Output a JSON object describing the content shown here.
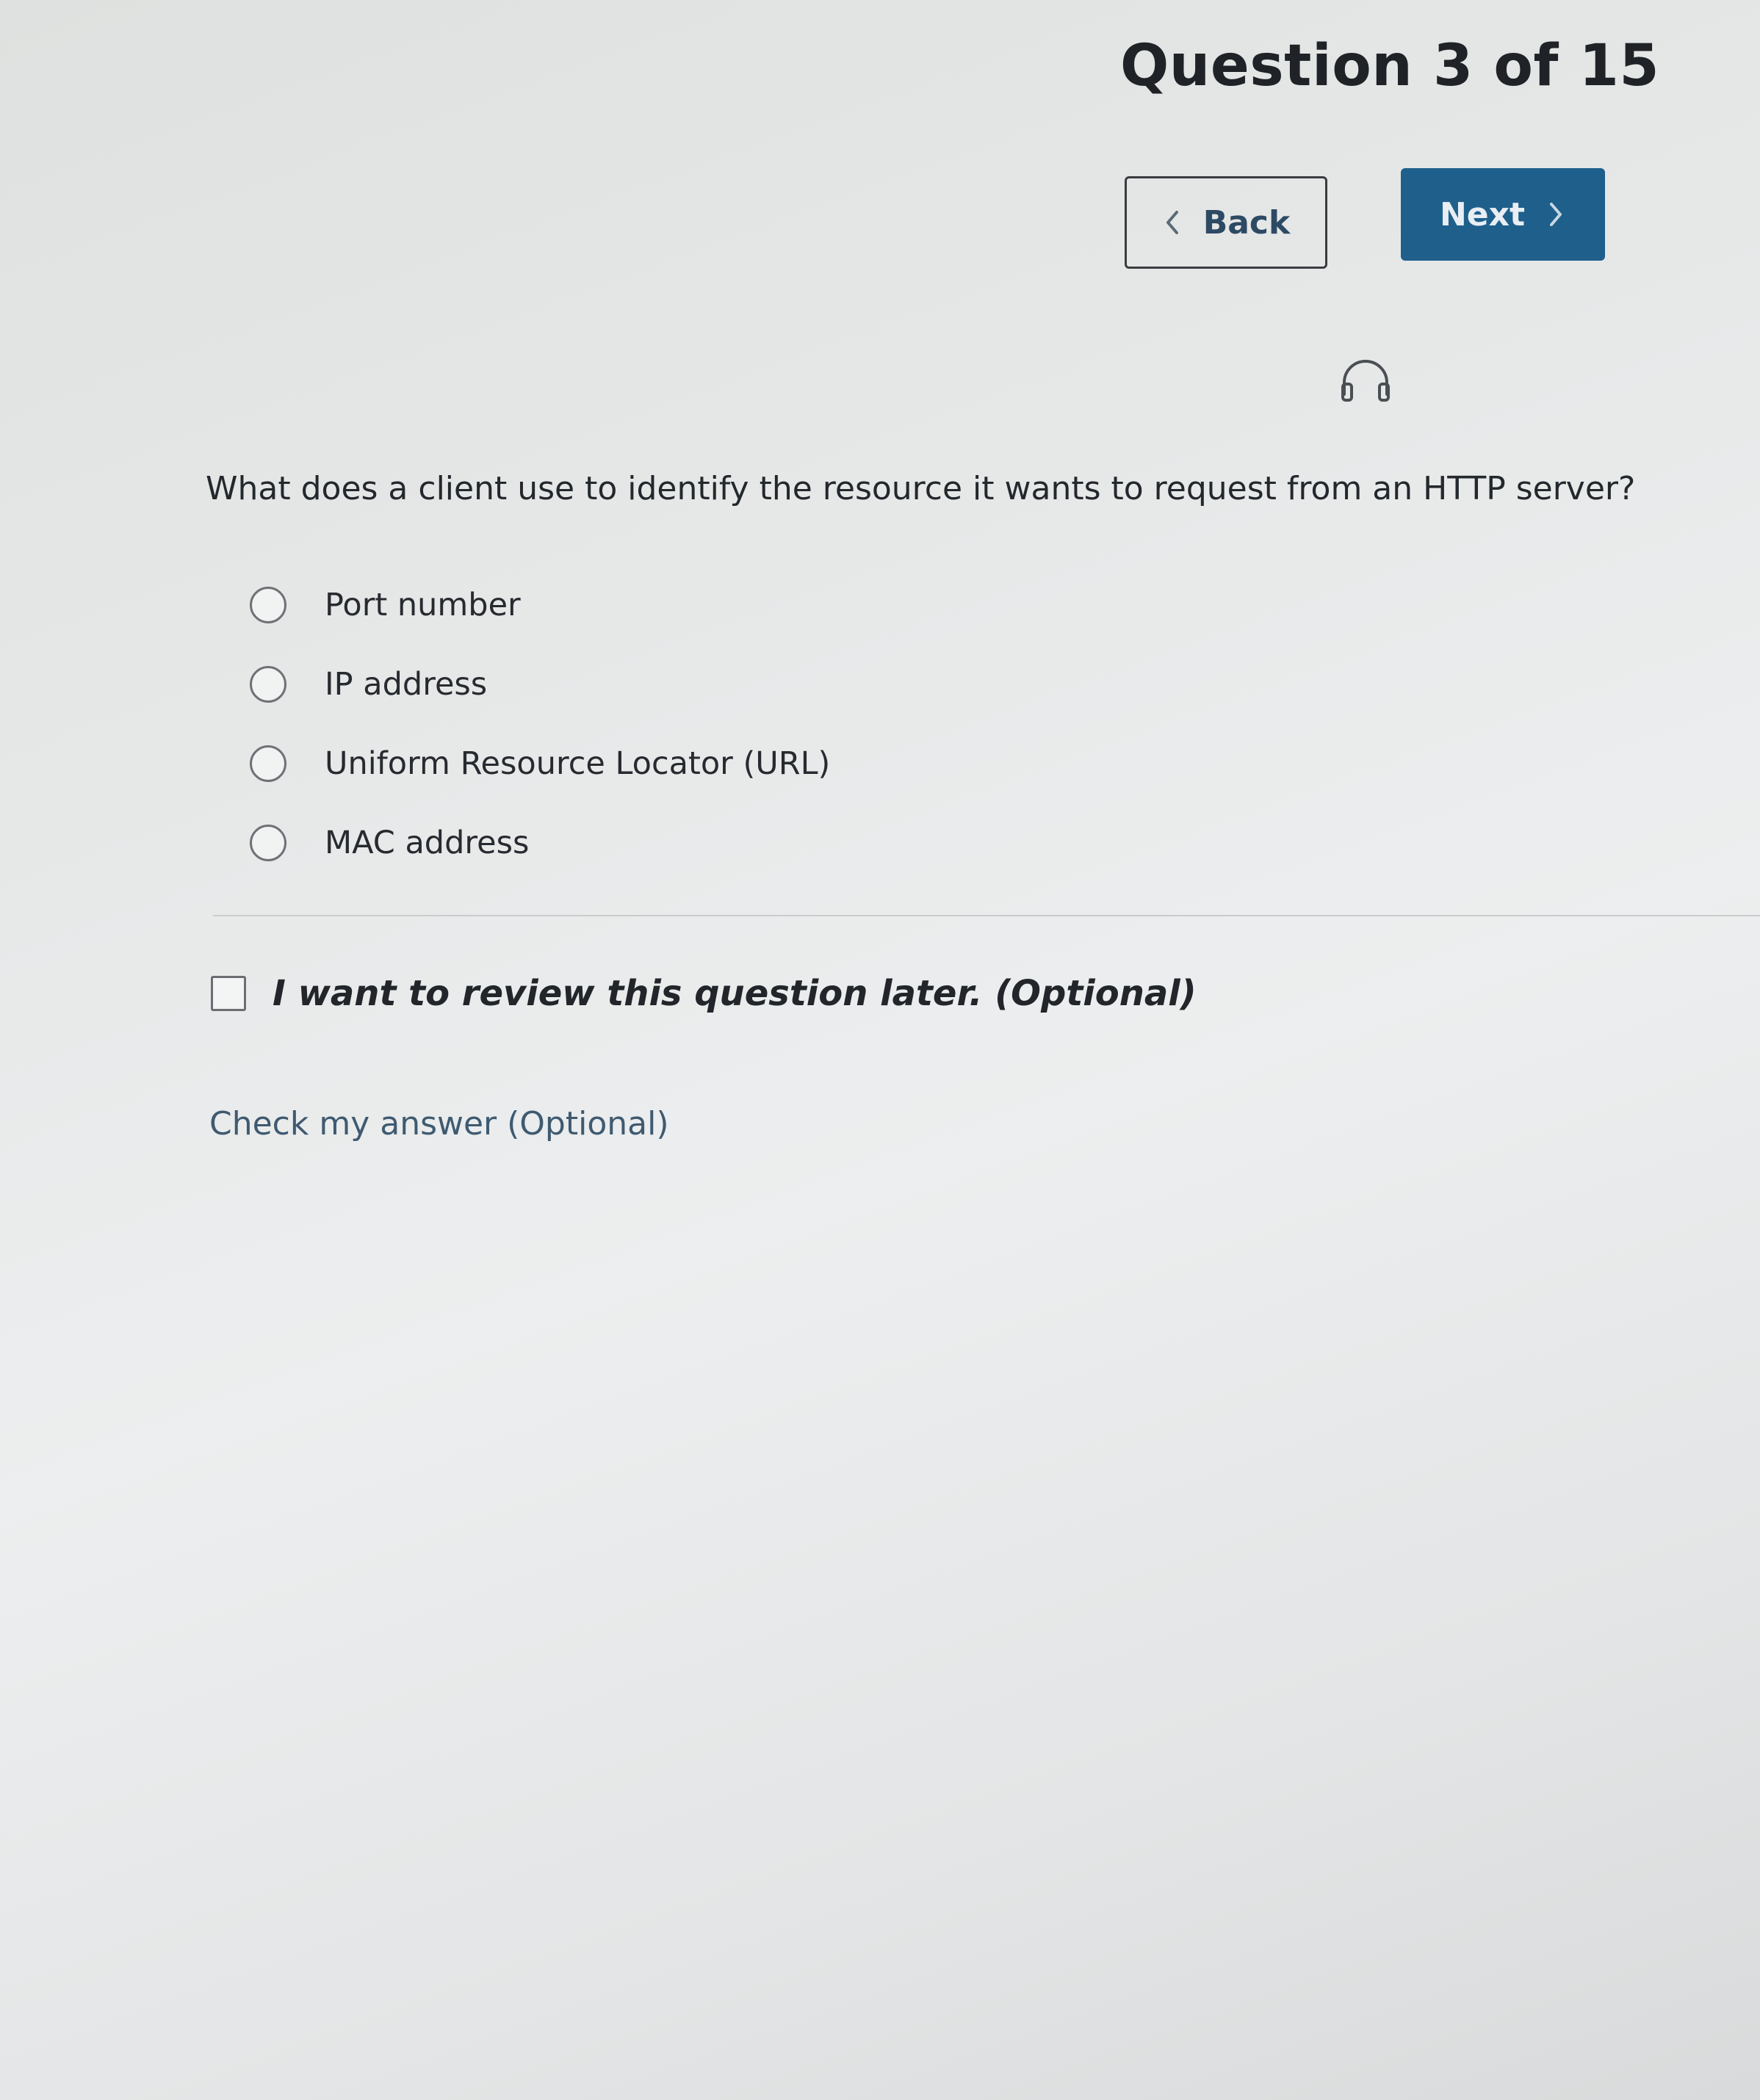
{
  "header": {
    "question_counter": "Question 3 of 15"
  },
  "navigation": {
    "back_label": "Back",
    "next_label": "Next",
    "back_icon": "chevron-left-icon",
    "next_icon": "chevron-right-icon",
    "next_color": "#1e5f8c"
  },
  "audio": {
    "icon": "headphones-icon"
  },
  "question": {
    "text": "What does a client use to identify the resource it wants to request from an HTTP server?",
    "options": [
      {
        "label": "Port number",
        "selected": false
      },
      {
        "label": "IP address",
        "selected": false
      },
      {
        "label": "Uniform Resource Locator (URL)",
        "selected": false
      },
      {
        "label": "MAC address",
        "selected": false
      }
    ]
  },
  "review": {
    "label": "I want to review this question later. (Optional)",
    "checked": false
  },
  "check_answer": {
    "label": "Check my answer (Optional)"
  }
}
